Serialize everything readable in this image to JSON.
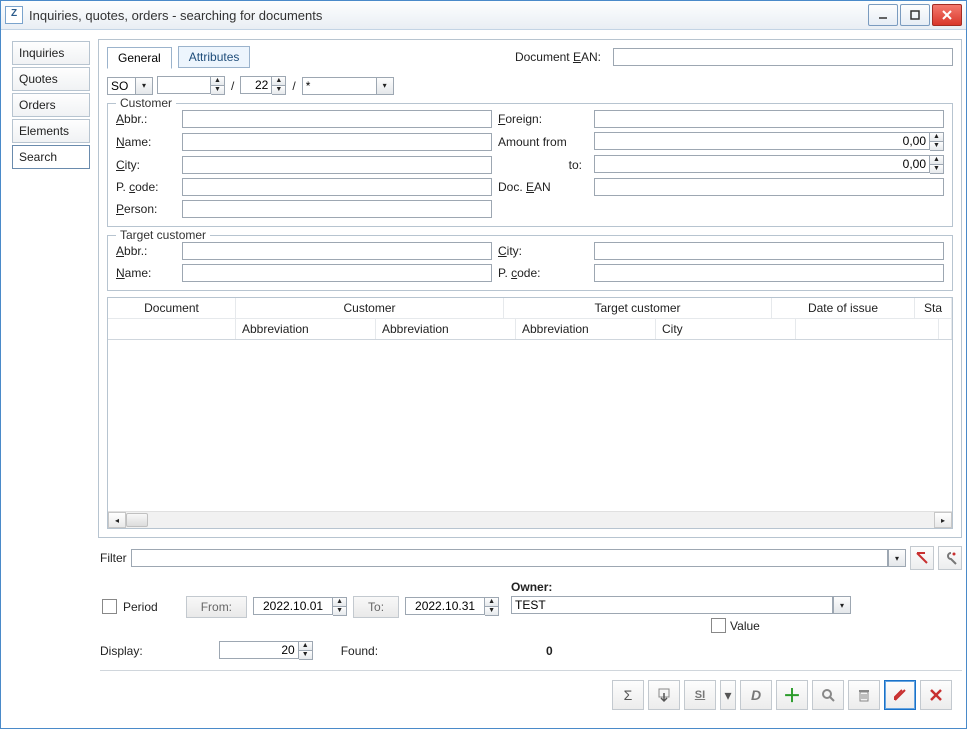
{
  "app_icon_letter": "Z",
  "title": "Inquiries, quotes, orders - searching for documents",
  "sidebar": [
    {
      "label": "Inquiries",
      "active": false
    },
    {
      "label": "Quotes",
      "active": false
    },
    {
      "label": "Orders",
      "active": false
    },
    {
      "label": "Elements",
      "active": false
    },
    {
      "label": "Search",
      "active": true
    }
  ],
  "tabs": {
    "general": "General",
    "attributes": "Attributes"
  },
  "ean_label_pre": "Document ",
  "ean_label_u": "E",
  "ean_label_post": "AN:",
  "ean_value": "",
  "docline": {
    "prefix": "SO",
    "seq": "",
    "year": "22",
    "pattern": "*"
  },
  "customer_legend": "Customer",
  "customer": {
    "abbr_u": "A",
    "abbr_post": "bbr.:",
    "abbr": "",
    "name_u": "N",
    "name_post": "ame:",
    "name": "",
    "city_pre": "",
    "city_u": "C",
    "city_post": "ity:",
    "city": "",
    "pcode_pre": "P. ",
    "pcode_u": "c",
    "pcode_post": "ode:",
    "pcode": "",
    "person_u": "P",
    "person_post": "erson:",
    "person": "",
    "foreign_u": "F",
    "foreign_post": "oreign:",
    "foreign": "",
    "amount_from_label": "Amount from",
    "amount_from": "0,00",
    "amount_to_label": "to:",
    "amount_to": "0,00",
    "docean_pre": "Doc. ",
    "docean_u": "E",
    "docean_post": "AN",
    "docean": ""
  },
  "target_legend": "Target customer",
  "target": {
    "abbr_u": "A",
    "abbr_post": "bbr.:",
    "abbr": "",
    "name_u": "N",
    "name_post": "ame:",
    "name": "",
    "city_u": "C",
    "city_post": "ity:",
    "city": "",
    "pcode_pre": "P. ",
    "pcode_u": "c",
    "pcode_post": "ode:",
    "pcode": ""
  },
  "grid": {
    "headers_top": {
      "document": "Document",
      "customer": "Customer",
      "target": "Target customer",
      "date": "Date of issue",
      "status": "Sta"
    },
    "headers_sub": {
      "abbr1": "Abbreviation",
      "abbr2": "Abbreviation",
      "abbr3": "Abbreviation",
      "city": "City"
    }
  },
  "filter_label": "Filter",
  "filter_value": "",
  "period": {
    "checkbox_label": "Period",
    "from_label": "From:",
    "from": "2022.10.01",
    "to_label": "To:",
    "to": "2022.10.31"
  },
  "owner": {
    "label": "Owner:",
    "value": "TEST"
  },
  "value_checkbox_label": "Value",
  "display_label": "Display:",
  "display_value": "20",
  "found_label": "Found:",
  "found_value": "0",
  "filter_icon_tooltips": {
    "reset": "Reset filter",
    "config": "Configure"
  },
  "footer_icons": {
    "sigma": "Σ",
    "stack": "⇩",
    "si": "SI",
    "d": "D",
    "add": "+",
    "search": "🔍",
    "delete": "🗑",
    "edit": "✎",
    "close": "✕"
  }
}
